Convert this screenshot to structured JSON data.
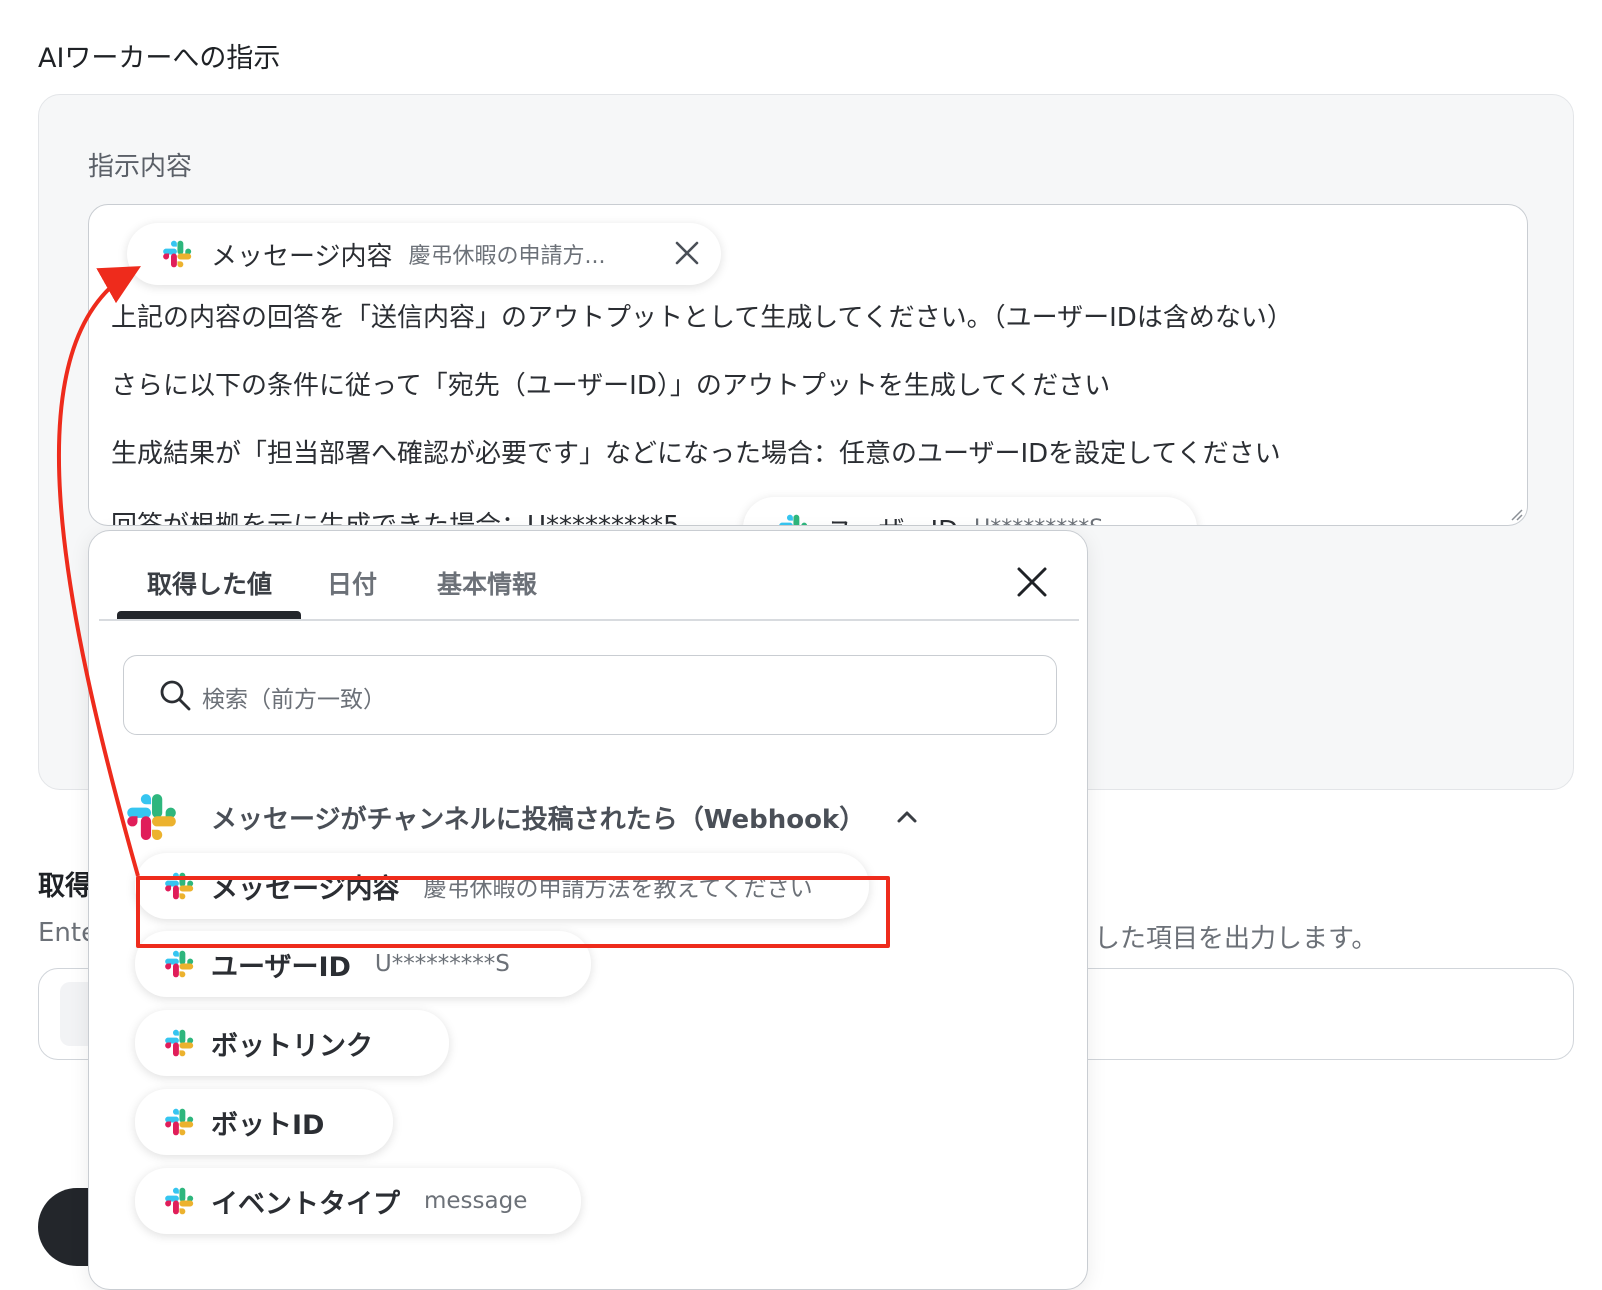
{
  "section_title": "AIワーカーへの指示",
  "instruction_label": "指示内容",
  "editor": {
    "chip_top": {
      "label": "メッセージ内容",
      "value": "慶弔休暇の申請方...",
      "icon": "slack-icon"
    },
    "lines": [
      "上記の内容の回答を「送信内容」のアウトプットとして生成してください。（ユーザーIDは含めない）",
      "さらに以下の条件に従って「宛先（ユーザーID）」のアウトプットを生成してください",
      "生成結果が「担当部署へ確認が必要です」などになった場合：任意のユーザーIDを設定してください",
      "回答が根拠を元に生成できた場合：U*********5"
    ],
    "chip_bottom": {
      "label": "ユーザーID",
      "value": "U*********S"
    }
  },
  "extract_label": "取得",
  "desc_left": "Ente",
  "desc_right": "した項目を出力します。",
  "dropdown": {
    "tabs": [
      "取得した値",
      "日付",
      "基本情報"
    ],
    "active_tab": 0,
    "search_placeholder": "検索（前方一致）",
    "group_title": "メッセージがチャンネルに投稿されたら（Webhook）",
    "items": [
      {
        "label": "メッセージ内容",
        "value": "慶弔休暇の申請方法を教えてください",
        "highlighted": true
      },
      {
        "label": "ユーザーID",
        "value": "U*********S"
      },
      {
        "label": "ボットリンク",
        "value": ""
      },
      {
        "label": "ボットID",
        "value": ""
      },
      {
        "label": "イベントタイプ",
        "value": "message"
      }
    ]
  },
  "colors": {
    "accent_red": "#ee2b1c",
    "panel_bg": "#f6f7f8",
    "dark": "#23262b"
  }
}
